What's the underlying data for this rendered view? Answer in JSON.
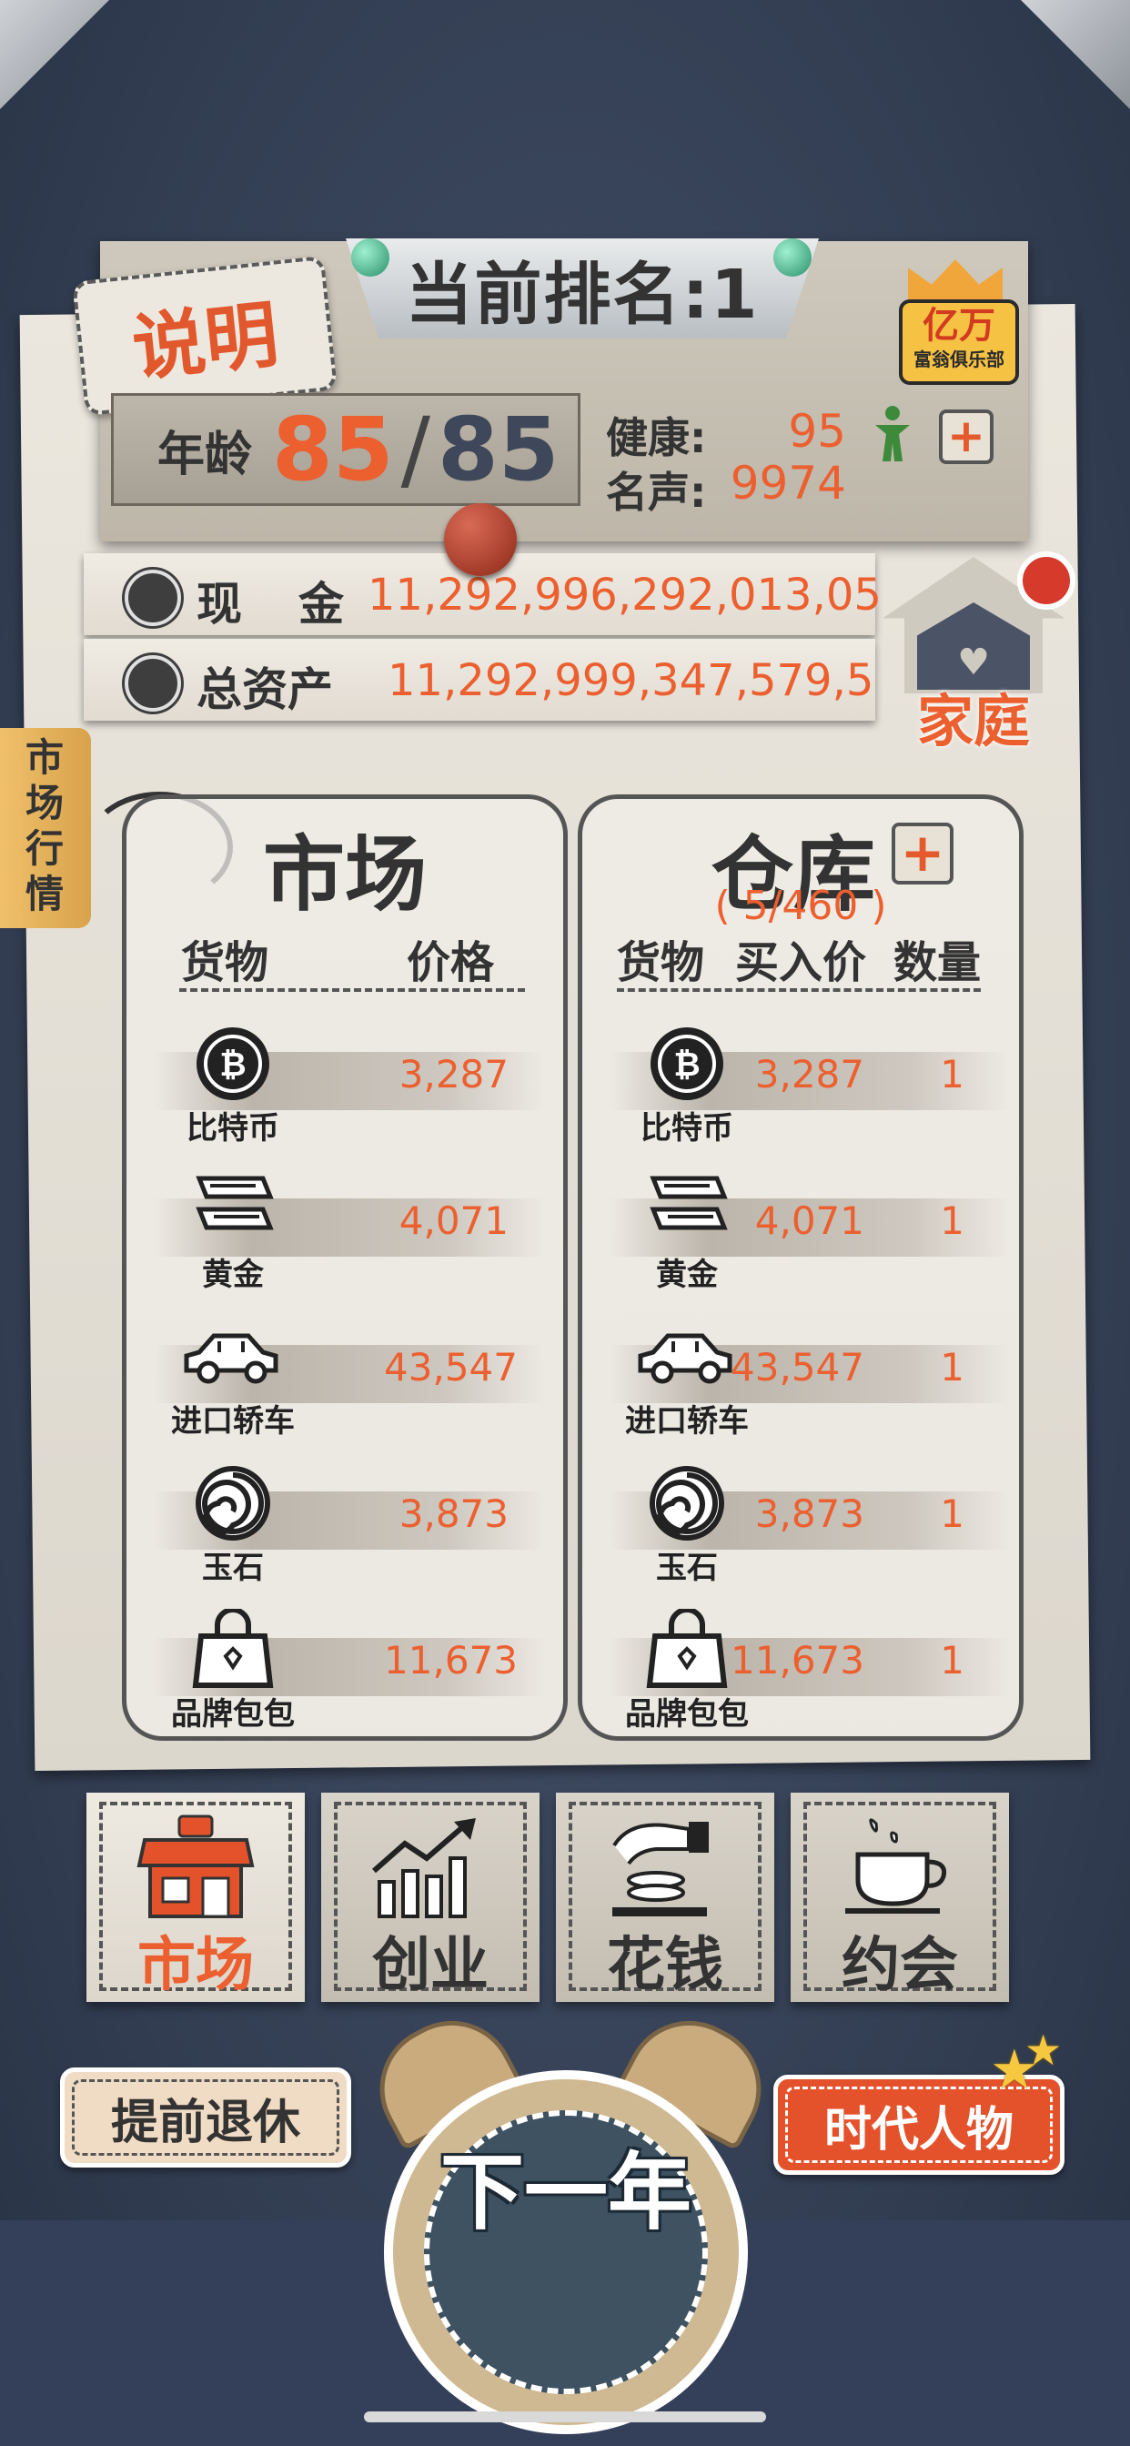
{
  "header": {
    "rank_label": "当前排名:1",
    "explain_button": "说明",
    "club_badge_title": "亿万",
    "club_badge_sub": "富翁俱乐部"
  },
  "stats": {
    "age_label": "年龄",
    "age_current": "85",
    "age_separator": "/",
    "age_max": "85",
    "health_label": "健康:",
    "health_value": "95",
    "fame_label": "名声:",
    "fame_value": "9974",
    "cash_label": "现　金",
    "cash_value": "11,292,996,292,013,05",
    "assets_label": "总资产",
    "assets_value": "11,292,999,347,579,5",
    "family_label": "家庭"
  },
  "side_tab": {
    "label": "市场行情"
  },
  "market": {
    "title": "市场",
    "col_goods": "货物",
    "col_price": "价格",
    "items": [
      {
        "name": "比特币",
        "price": "3,287",
        "icon": "bitcoin-icon"
      },
      {
        "name": "黄金",
        "price": "4,071",
        "icon": "gold-bar-icon"
      },
      {
        "name": "进口轿车",
        "price": "43,547",
        "icon": "car-icon"
      },
      {
        "name": "玉石",
        "price": "3,873",
        "icon": "jade-icon"
      },
      {
        "name": "品牌包包",
        "price": "11,673",
        "icon": "handbag-icon"
      }
    ]
  },
  "warehouse": {
    "title": "仓库",
    "capacity": "( 5/460 )",
    "col_goods": "货物",
    "col_buy_price": "买入价",
    "col_qty": "数量",
    "items": [
      {
        "name": "比特币",
        "buy_price": "3,287",
        "qty": "1",
        "icon": "bitcoin-icon"
      },
      {
        "name": "黄金",
        "buy_price": "4,071",
        "qty": "1",
        "icon": "gold-bar-icon"
      },
      {
        "name": "进口轿车",
        "buy_price": "43,547",
        "qty": "1",
        "icon": "car-icon"
      },
      {
        "name": "玉石",
        "buy_price": "3,873",
        "qty": "1",
        "icon": "jade-icon"
      },
      {
        "name": "品牌包包",
        "buy_price": "11,673",
        "qty": "1",
        "icon": "handbag-icon"
      }
    ]
  },
  "tabs": [
    {
      "label": "市场",
      "icon": "shop-icon",
      "active": true
    },
    {
      "label": "创业",
      "icon": "growth-chart-icon",
      "active": false
    },
    {
      "label": "花钱",
      "icon": "spend-money-icon",
      "active": false
    },
    {
      "label": "约会",
      "icon": "coffee-cup-icon",
      "active": false
    }
  ],
  "actions": {
    "retire_label": "提前退休",
    "next_year_label": "下一年",
    "era_people_label": "时代人物"
  },
  "colors": {
    "accent": "#ec5f2f",
    "background": "#37435a",
    "paper": "#e7e3da",
    "text": "#333333"
  }
}
